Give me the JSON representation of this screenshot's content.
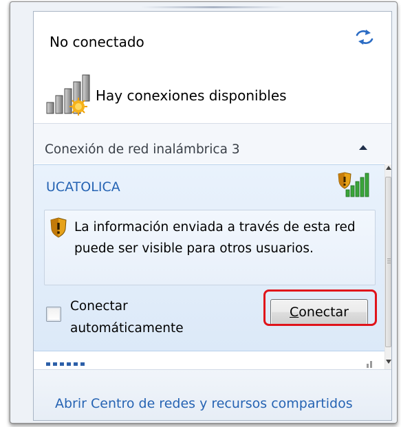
{
  "status": {
    "title": "No conectado",
    "available_text": "Hay conexiones disponibles"
  },
  "section": {
    "label": "Conexión de red inalámbrica 3"
  },
  "network": {
    "name": "UCATOLICA",
    "warning": "La información enviada a través de esta red puede ser visible para otros usuarios.",
    "auto_connect_label": "Conectar automáticamente",
    "auto_connect_checked": false,
    "connect_button_accesskey": "C",
    "connect_button_rest": "onectar"
  },
  "footer": {
    "link": "Abrir Centro de redes y recursos compartidos"
  },
  "colors": {
    "link": "#2563b3",
    "highlight": "#e0131a",
    "card_bg": "#dce9f8"
  },
  "icons": [
    "refresh-icon",
    "network-available-icon",
    "collapse-icon",
    "secured-signal-icon",
    "shield-warning-icon",
    "signal-bars-icon"
  ]
}
